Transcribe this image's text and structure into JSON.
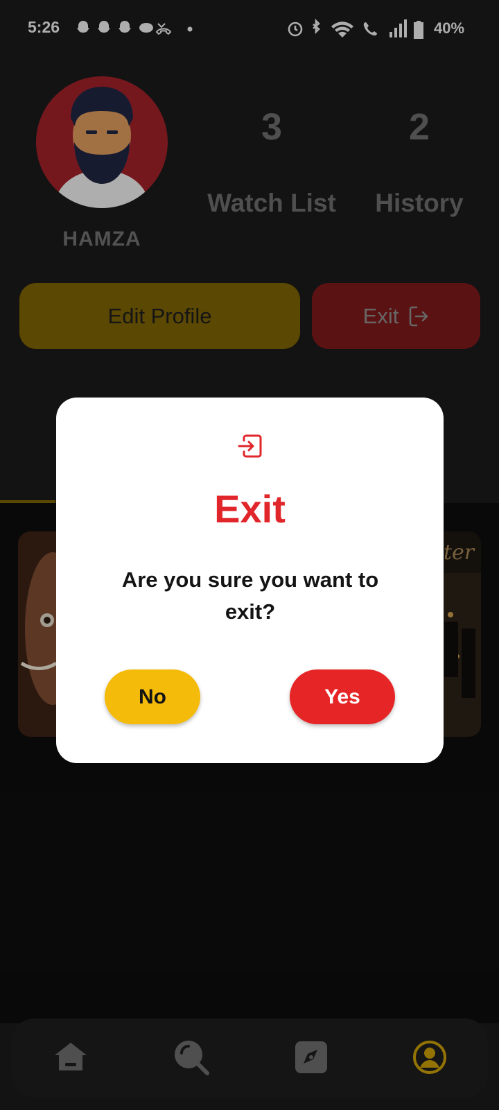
{
  "status_bar": {
    "time": "5:26",
    "battery_percent": "40%",
    "notification_icons": [
      "snapchat-icon",
      "snapchat-icon",
      "snapchat-icon",
      "message-icon",
      "missed-call-icon",
      "dot-icon"
    ],
    "system_icons": [
      "alarm-icon",
      "bluetooth-icon",
      "wifi-icon",
      "wifi-call-icon",
      "signal-icon",
      "battery-icon"
    ]
  },
  "profile": {
    "username": "HAMZA",
    "stats": [
      {
        "value": "3",
        "label": "Watch List"
      },
      {
        "value": "2",
        "label": "History"
      }
    ],
    "edit_button_label": "Edit Profile",
    "exit_button_label": "Exit"
  },
  "dialog": {
    "icon": "exit-icon",
    "title": "Exit",
    "message": "Are you sure you want to exit?",
    "no_label": "No",
    "yes_label": "Yes"
  },
  "nav": {
    "items": [
      {
        "name": "home",
        "icon": "home-icon",
        "active": false
      },
      {
        "name": "search",
        "icon": "search-icon",
        "active": false
      },
      {
        "name": "explore",
        "icon": "compass-icon",
        "active": false
      },
      {
        "name": "profile",
        "icon": "profile-icon",
        "active": true
      }
    ]
  },
  "colors": {
    "accent_yellow": "#f5bb0a",
    "accent_red": "#e62626",
    "background": "#1a1a1a",
    "nav_active": "#c49a06"
  }
}
